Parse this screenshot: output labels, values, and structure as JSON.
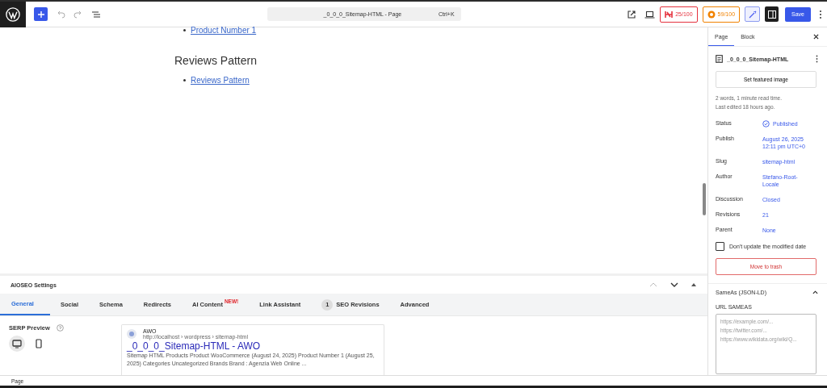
{
  "top_bar": {
    "document_title": "_0_0_0_Sitemap-HTML - Page",
    "shortcut": "Ctrl+K",
    "scores": [
      {
        "label": "25/100",
        "kind": "headline",
        "color": "#e5323e"
      },
      {
        "label": "59/100",
        "kind": "truseo",
        "color": "#f18200"
      }
    ],
    "save_label": "Save"
  },
  "canvas": {
    "items": [
      {
        "kind": "link",
        "text": "Product Number 1"
      },
      {
        "kind": "heading",
        "text": "Reviews Pattern"
      },
      {
        "kind": "link",
        "text": "Reviews Pattern"
      }
    ]
  },
  "aioseo": {
    "title": "AIOSEO Settings",
    "tabs": [
      {
        "label": "General",
        "selected": true
      },
      {
        "label": "Social",
        "selected": false
      },
      {
        "label": "Schema",
        "selected": false
      },
      {
        "label": "Redirects",
        "selected": false
      },
      {
        "label": "AI Content",
        "badge": "NEW!",
        "selected": false
      },
      {
        "label": "Link Assistant",
        "selected": false
      },
      {
        "label": "SEO Revisions",
        "count": "1",
        "selected": false
      },
      {
        "label": "Advanced",
        "selected": false
      }
    ],
    "serp": {
      "label": "SERP Preview",
      "devices": [
        {
          "kind": "desktop",
          "selected": true
        },
        {
          "kind": "mobile",
          "selected": false
        }
      ],
      "site_name": "AWO",
      "url": "http://localhost › wordpress › sitemap-html",
      "title": "_0_0_0_Sitemap-HTML - AWO",
      "description": "Sitemap HTML Products Product WooCommerce (August 24, 2025) Product Number 1 (August 25, 2025) Categories Uncategorized Brands Brand : Agenzia Web Online ..."
    }
  },
  "sidebar": {
    "tabs": [
      {
        "label": "Page",
        "selected": true
      },
      {
        "label": "Block",
        "selected": false
      }
    ],
    "page_title": "_0_0_0_Sitemap-HTML",
    "featured_button": "Set featured image",
    "stats": [
      "2 words, 1 minute read time.",
      "Last edited 18 hours ago."
    ],
    "fields": [
      {
        "label": "Status",
        "value": "Published",
        "kind": "status"
      },
      {
        "label": "Publish",
        "value": "August 26, 2025 12:11 pm UTC+0",
        "kind": "link"
      },
      {
        "label": "Slug",
        "value": "sitemap-html",
        "kind": "link"
      },
      {
        "label": "Author",
        "value": "Stefano-Root-Locale",
        "kind": "link"
      },
      {
        "label": "Discussion",
        "value": "Closed",
        "kind": "link"
      },
      {
        "label": "Revisions",
        "value": "21",
        "kind": "link"
      },
      {
        "label": "Parent",
        "value": "None",
        "kind": "link"
      }
    ],
    "checkbox": {
      "label": "Don't update the modified date",
      "checked": false
    },
    "trash_button": "Move to trash",
    "sameas": {
      "title": "SameAs (JSON-LD)",
      "expanded": true,
      "field_label": "URL SAMEAS",
      "placeholder": "https://example.com/...\nhttps://twitter.com/...\nhttps://www.wikidata.org/wiki/Q..."
    }
  },
  "status_bar": "Page"
}
